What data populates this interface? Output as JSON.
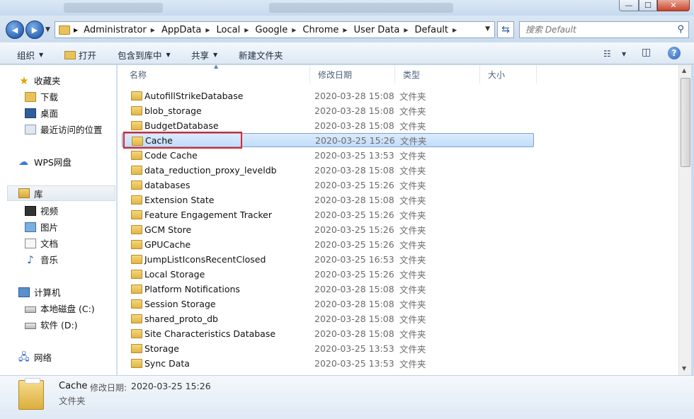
{
  "window": {
    "minimize_label": "—",
    "maximize_label": "☐",
    "close_label": "✕"
  },
  "nav": {
    "back_label": "◀",
    "forward_label": "▶",
    "breadcrumbs": [
      "Administrator",
      "AppData",
      "Local",
      "Google",
      "Chrome",
      "User Data",
      "Default"
    ],
    "search_placeholder": "搜索 Default"
  },
  "toolbar": {
    "organize": "组织",
    "open": "打开",
    "include_in_library": "包含到库中",
    "share": "共享",
    "new_folder": "新建文件夹"
  },
  "sidebar": {
    "favorites": "收藏夹",
    "downloads": "下载",
    "desktop": "桌面",
    "recent": "最近访问的位置",
    "wps": "WPS网盘",
    "libraries": "库",
    "videos": "视频",
    "pictures": "图片",
    "documents": "文档",
    "music": "音乐",
    "computer": "计算机",
    "drive_c": "本地磁盘 (C:)",
    "drive_d": "软件 (D:)",
    "network": "网络"
  },
  "columns": {
    "name": "名称",
    "date": "修改日期",
    "type": "类型",
    "size": "大小"
  },
  "files": [
    {
      "name": "AutofillStrikeDatabase",
      "date": "2020-03-28 15:08",
      "type": "文件夹"
    },
    {
      "name": "blob_storage",
      "date": "2020-03-28 15:08",
      "type": "文件夹"
    },
    {
      "name": "BudgetDatabase",
      "date": "2020-03-28 15:08",
      "type": "文件夹"
    },
    {
      "name": "Cache",
      "date": "2020-03-25 15:26",
      "type": "文件夹"
    },
    {
      "name": "Code Cache",
      "date": "2020-03-25 13:53",
      "type": "文件夹"
    },
    {
      "name": "data_reduction_proxy_leveldb",
      "date": "2020-03-28 15:08",
      "type": "文件夹"
    },
    {
      "name": "databases",
      "date": "2020-03-25 15:26",
      "type": "文件夹"
    },
    {
      "name": "Extension State",
      "date": "2020-03-28 15:08",
      "type": "文件夹"
    },
    {
      "name": "Feature Engagement Tracker",
      "date": "2020-03-25 15:26",
      "type": "文件夹"
    },
    {
      "name": "GCM Store",
      "date": "2020-03-25 15:26",
      "type": "文件夹"
    },
    {
      "name": "GPUCache",
      "date": "2020-03-25 15:26",
      "type": "文件夹"
    },
    {
      "name": "JumpListIconsRecentClosed",
      "date": "2020-03-25 16:53",
      "type": "文件夹"
    },
    {
      "name": "Local Storage",
      "date": "2020-03-25 15:26",
      "type": "文件夹"
    },
    {
      "name": "Platform Notifications",
      "date": "2020-03-28 15:08",
      "type": "文件夹"
    },
    {
      "name": "Session Storage",
      "date": "2020-03-28 15:08",
      "type": "文件夹"
    },
    {
      "name": "shared_proto_db",
      "date": "2020-03-28 15:08",
      "type": "文件夹"
    },
    {
      "name": "Site Characteristics Database",
      "date": "2020-03-28 15:08",
      "type": "文件夹"
    },
    {
      "name": "Storage",
      "date": "2020-03-25 13:53",
      "type": "文件夹"
    },
    {
      "name": "Sync Data",
      "date": "2020-03-25 13:53",
      "type": "文件夹"
    }
  ],
  "selected_index": 3,
  "details": {
    "name": "Cache",
    "date_label": "修改日期:",
    "date": "2020-03-25 15:26",
    "type": "文件夹"
  },
  "colors": {
    "selection": "#cce4fc",
    "highlight_box": "#e0242a"
  }
}
